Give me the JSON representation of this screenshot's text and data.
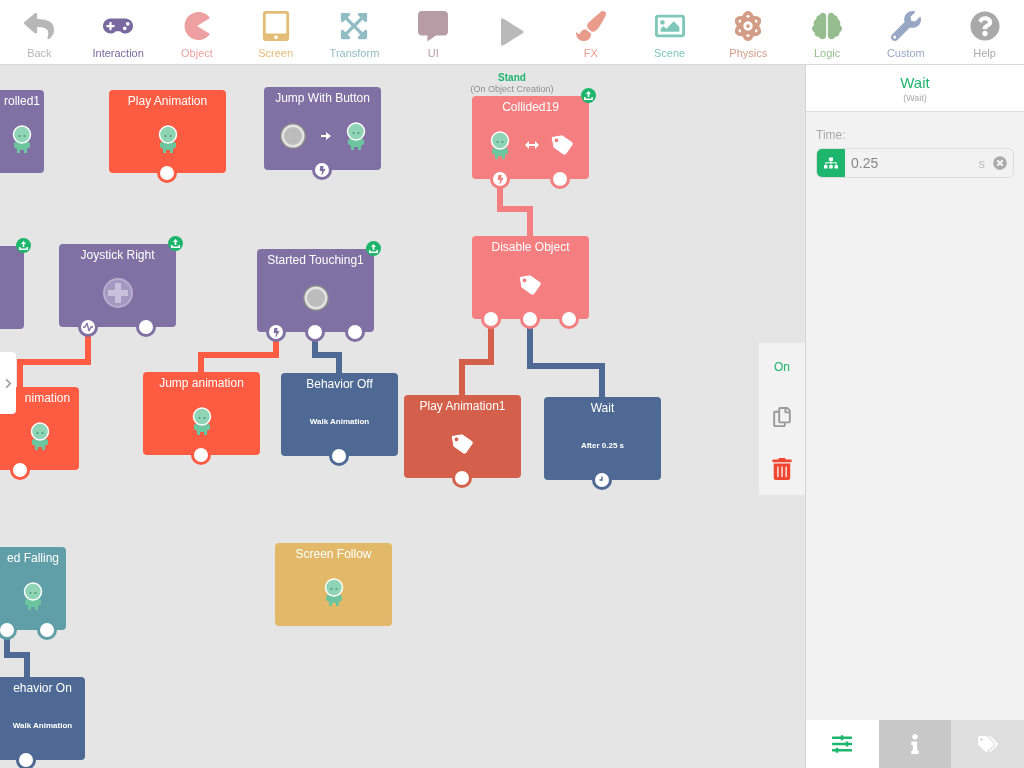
{
  "toolbar": {
    "items": [
      {
        "kind": "category",
        "label": "Back",
        "color": "#b7b7b7"
      },
      {
        "kind": "category",
        "label": "Interaction",
        "color": "#7a68a0"
      },
      {
        "kind": "category",
        "label": "Object",
        "color": "#ee9f9f"
      },
      {
        "kind": "category",
        "label": "Screen",
        "color": "#e3bd78"
      },
      {
        "kind": "category",
        "label": "Transform",
        "color": "#92bcc4"
      },
      {
        "kind": "category",
        "label": "UI",
        "color": "#b79ca6"
      },
      {
        "kind": "play",
        "color": "#b9b9b9"
      },
      {
        "kind": "category",
        "label": "FX",
        "color": "#e99c8b"
      },
      {
        "kind": "category",
        "label": "Scene",
        "color": "#7fc6bb"
      },
      {
        "kind": "category",
        "label": "Physics",
        "color": "#d39c87"
      },
      {
        "kind": "category",
        "label": "Logic",
        "color": "#95bd8e"
      },
      {
        "kind": "category",
        "label": "Custom",
        "color": "#98a7c4"
      },
      {
        "kind": "category",
        "label": "Help",
        "color": "#a9a9a9"
      }
    ]
  },
  "canvas": {
    "stand_label": "Stand",
    "stand_sublabel": "(On Object Creation)",
    "nodes": [
      {
        "title": "rolled1",
        "color": "#8070a3",
        "kind": "actor",
        "exported": false
      },
      {
        "title": "Play Animation",
        "color": "#fe5b43",
        "kind": "actor",
        "exported": false,
        "ports": [
          {
            "kind": "plain"
          }
        ]
      },
      {
        "title": "Jump With Button",
        "color": "#8070a3",
        "kind": "button-actor",
        "exported": false,
        "ports": [
          {
            "kind": "trigger"
          }
        ]
      },
      {
        "title": "Collided19",
        "color": "#f47e80",
        "kind": "collision",
        "exported": true,
        "ports": [
          {
            "kind": "trigger"
          },
          {
            "kind": "plain"
          }
        ]
      },
      {
        "color": "#8070a3",
        "kind": "empty",
        "exported": true
      },
      {
        "title": "Joystick Right",
        "color": "#8070a3",
        "kind": "joystick",
        "exported": true,
        "ports": [
          {
            "kind": "pulse"
          },
          {
            "kind": "plain"
          }
        ]
      },
      {
        "title": "Started Touching1",
        "color": "#8070a3",
        "kind": "button",
        "exported": true,
        "ports": [
          {
            "kind": "trigger"
          },
          {
            "kind": "plain"
          },
          {
            "kind": "plain"
          }
        ]
      },
      {
        "title": "Disable Object",
        "color": "#f47e80",
        "kind": "tag",
        "exported": false,
        "ports": [
          {
            "kind": "plain"
          },
          {
            "kind": "plain"
          },
          {
            "kind": "plain"
          }
        ]
      },
      {
        "title": "nimation",
        "color": "#fe5b43",
        "kind": "actor",
        "exported": false,
        "ports": [
          {
            "kind": "plain"
          }
        ]
      },
      {
        "title": "Jump animation",
        "color": "#fe5b43",
        "kind": "actor",
        "exported": false,
        "ports": [
          {
            "kind": "plain"
          }
        ]
      },
      {
        "title": "Behavior Off",
        "subtitle": "Walk Animation",
        "color": "#4e6a94",
        "kind": "text",
        "exported": false,
        "ports": [
          {
            "kind": "plain"
          }
        ]
      },
      {
        "title": "Play Animation1",
        "color": "#d4604b",
        "kind": "tag",
        "exported": false,
        "ports": [
          {
            "kind": "plain"
          }
        ]
      },
      {
        "title": "Wait",
        "subtitle": "After 0.25 s",
        "color": "#4e6a94",
        "kind": "text",
        "exported": false,
        "ports": [
          {
            "kind": "timer"
          }
        ]
      },
      {
        "title": "ed Falling",
        "color": "#619fa8",
        "kind": "actor",
        "exported": false,
        "ports": [
          {
            "kind": "plain"
          },
          {
            "kind": "plain"
          }
        ]
      },
      {
        "title": "ehavior On",
        "subtitle": "Walk Animation",
        "color": "#4e6a94",
        "kind": "text",
        "exported": false,
        "ports": [
          {
            "kind": "plain"
          }
        ]
      },
      {
        "title": "Screen Follow",
        "color": "#e2b968",
        "kind": "actor",
        "exported": false
      }
    ]
  },
  "side_tools": {
    "toggle_label": "On"
  },
  "inspector": {
    "title": "Wait",
    "subtitle": "(Wait)",
    "fields": [
      {
        "label": "Time:",
        "value": "0.25",
        "unit": "s"
      }
    ],
    "tabs": [
      {
        "selected": true,
        "disabled": false
      },
      {
        "selected": false,
        "disabled": false
      },
      {
        "selected": false,
        "disabled": true
      }
    ]
  }
}
